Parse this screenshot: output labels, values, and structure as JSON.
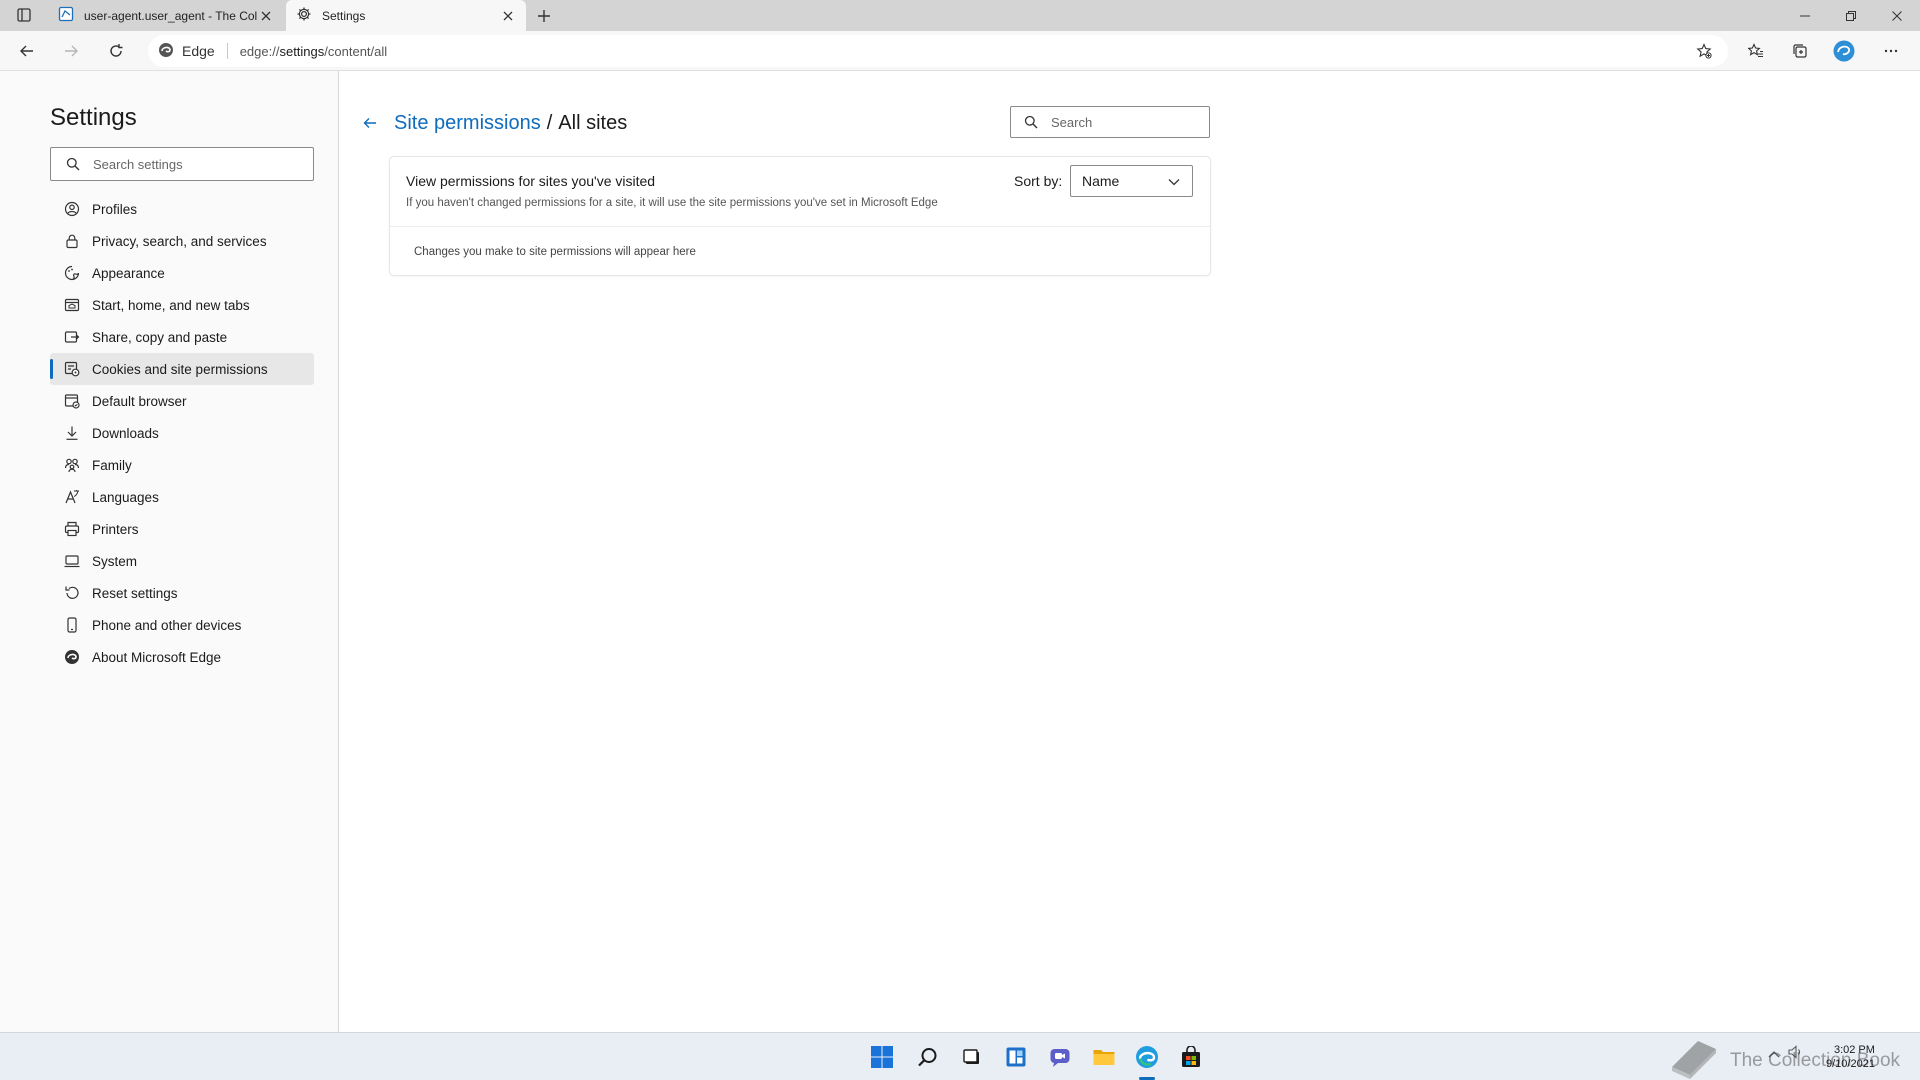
{
  "tabs": [
    {
      "title": "user-agent.user_agent - The Coll",
      "icon": "collection-book-icon",
      "active": false
    },
    {
      "title": "Settings",
      "icon": "gear-icon",
      "active": true
    }
  ],
  "address": {
    "identity": "Edge",
    "url_prefix": "edge://",
    "url_host": "settings",
    "url_path": "/content/all"
  },
  "sidebar": {
    "title": "Settings",
    "search_placeholder": "Search settings",
    "items": [
      {
        "label": "Profiles",
        "icon": "profile-icon"
      },
      {
        "label": "Privacy, search, and services",
        "icon": "lock-icon"
      },
      {
        "label": "Appearance",
        "icon": "appearance-icon"
      },
      {
        "label": "Start, home, and new tabs",
        "icon": "home-tab-icon"
      },
      {
        "label": "Share, copy and paste",
        "icon": "share-icon"
      },
      {
        "label": "Cookies and site permissions",
        "icon": "cookies-permissions-icon",
        "selected": true
      },
      {
        "label": "Default browser",
        "icon": "default-browser-icon"
      },
      {
        "label": "Downloads",
        "icon": "download-icon"
      },
      {
        "label": "Family",
        "icon": "family-icon"
      },
      {
        "label": "Languages",
        "icon": "languages-icon"
      },
      {
        "label": "Printers",
        "icon": "printer-icon"
      },
      {
        "label": "System",
        "icon": "system-icon"
      },
      {
        "label": "Reset settings",
        "icon": "reset-icon"
      },
      {
        "label": "Phone and other devices",
        "icon": "phone-icon"
      },
      {
        "label": "About Microsoft Edge",
        "icon": "edge-logo-icon"
      }
    ]
  },
  "main": {
    "breadcrumb_parent": "Site permissions",
    "breadcrumb_separator": "/",
    "breadcrumb_current": "All sites",
    "search_placeholder": "Search",
    "card": {
      "title": "View permissions for sites you've visited",
      "subtitle": "If you haven't changed permissions for a site, it will use the site permissions you've set in Microsoft Edge",
      "sort_label": "Sort by:",
      "sort_value": "Name",
      "empty_message": "Changes you make to site permissions will appear here"
    }
  },
  "taskbar": {
    "watermark": "The Collection Book",
    "time": "3:02 PM",
    "date": "9/10/2021"
  },
  "colors": {
    "accent": "#0f6cbd",
    "tab_strip": "#d4d4d4",
    "taskbar": "#e9eef5"
  }
}
